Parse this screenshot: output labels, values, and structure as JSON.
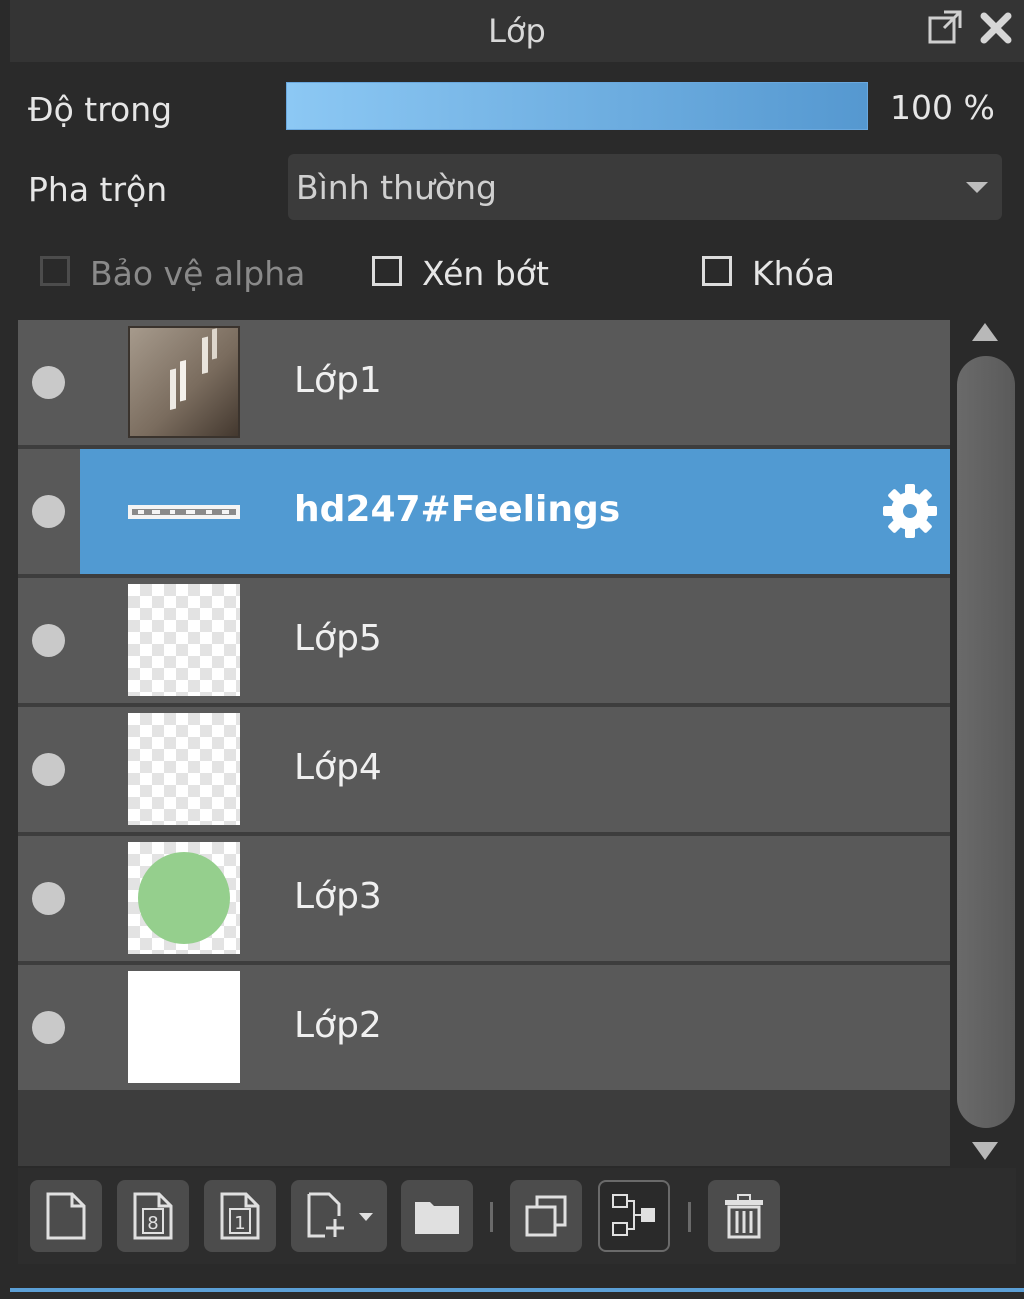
{
  "panel": {
    "title": "Lớp"
  },
  "opacity": {
    "label": "Độ trong",
    "value": "100 %",
    "percent": 100
  },
  "blend": {
    "label": "Pha trộn",
    "value": "Bình thường"
  },
  "options": {
    "alpha_protect": {
      "label": "Bảo vệ alpha",
      "checked": false,
      "enabled": false
    },
    "clipping": {
      "label": "Xén bớt",
      "checked": false,
      "enabled": true
    },
    "lock": {
      "label": "Khóa",
      "checked": false,
      "enabled": true
    }
  },
  "layers": [
    {
      "name": "Lớp1",
      "thumb": "photo-thumbnail",
      "selected": false
    },
    {
      "name": "hd247#Feelings",
      "thumb": "text-thumbnail",
      "selected": true
    },
    {
      "name": "Lớp5",
      "thumb": "transparent-thumbnail",
      "selected": false
    },
    {
      "name": "Lớp4",
      "thumb": "transparent-thumbnail",
      "selected": false
    },
    {
      "name": "Lớp3",
      "thumb": "green-circle-thumbnail",
      "selected": false
    },
    {
      "name": "Lớp2",
      "thumb": "white-thumbnail",
      "selected": false
    }
  ],
  "toolbar": {
    "buttons": [
      "new-layer-icon",
      "new-8bit-layer-icon",
      "new-1bit-layer-icon",
      "add-layer-menu-icon",
      "new-folder-icon",
      "duplicate-layer-icon",
      "merge-layer-icon",
      "delete-layer-icon"
    ]
  },
  "colors": {
    "selection": "#519ad2",
    "opacity_bar_start": "#8cc8f4",
    "opacity_bar_end": "#5598d0",
    "green_circle": "#95cf8d"
  }
}
